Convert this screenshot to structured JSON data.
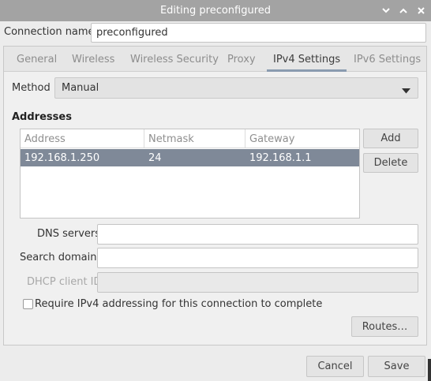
{
  "window": {
    "title": "Editing preconfigured",
    "controls": [
      "chevron-down-icon",
      "chevron-up-icon",
      "close-icon"
    ]
  },
  "connection": {
    "label": "Connection name",
    "value": "preconfigured"
  },
  "tabs": [
    {
      "label": "General",
      "active": false
    },
    {
      "label": "Wireless",
      "active": false
    },
    {
      "label": "Wireless Security",
      "active": false
    },
    {
      "label": "Proxy",
      "active": false
    },
    {
      "label": "IPv4 Settings",
      "active": true
    },
    {
      "label": "IPv6 Settings",
      "active": false
    }
  ],
  "ipv4": {
    "method_label": "Method",
    "method_value": "Manual",
    "addresses_heading": "Addresses",
    "columns": [
      "Address",
      "Netmask",
      "Gateway"
    ],
    "rows": [
      {
        "address": "192.168.1.250",
        "netmask": "24",
        "gateway": "192.168.1.1",
        "selected": true
      }
    ],
    "add_label": "Add",
    "delete_label": "Delete",
    "dns_label": "DNS servers",
    "dns_value": "",
    "search_label": "Search domains",
    "search_value": "",
    "dhcp_label": "DHCP client ID",
    "dhcp_value": "",
    "require_label": "Require IPv4 addressing for this connection to complete",
    "require_checked": false,
    "routes_label": "Routes…"
  },
  "footer": {
    "cancel_label": "Cancel",
    "save_label": "Save"
  },
  "colors": {
    "titlebar": "#a3a3a3",
    "selected_row": "#7f8998",
    "active_tab_underline": "#8a9bb0"
  }
}
